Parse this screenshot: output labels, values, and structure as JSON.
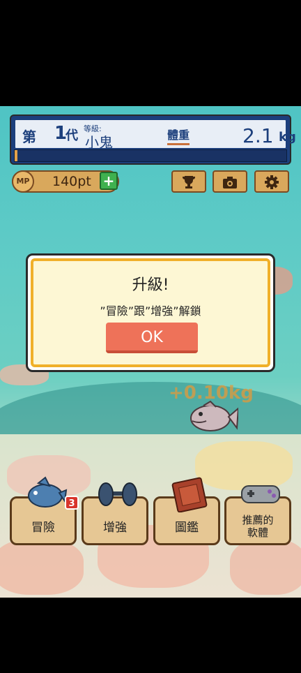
{
  "hud": {
    "generation_prefix": "第",
    "generation_number": "1",
    "generation_suffix": "代",
    "rank_label": "等級:",
    "rank": "小鬼",
    "weight_label": "體重",
    "weight_value": "2.1",
    "weight_unit": "kg",
    "progress": 0.01
  },
  "mp": {
    "badge": "MP",
    "value": "140pt",
    "plus": "+"
  },
  "toolbar": {
    "icons": [
      "trophy-icon",
      "camera-icon",
      "gear-icon"
    ]
  },
  "dialog": {
    "title": "升級!",
    "message": "”冒險”跟”增強”解鎖",
    "ok_label": "OK"
  },
  "floating_text": "+0.10kg",
  "menu": [
    {
      "label": "冒險",
      "badge": "3"
    },
    {
      "label": "增強"
    },
    {
      "label": "圖鑑"
    },
    {
      "label": "推薦的\n軟體"
    }
  ],
  "colors": {
    "hud_blue": "#1c3f7c",
    "accent_orange": "#ee7259",
    "dialog_border": "#f0b02a",
    "plus_green": "#3fb14f"
  }
}
